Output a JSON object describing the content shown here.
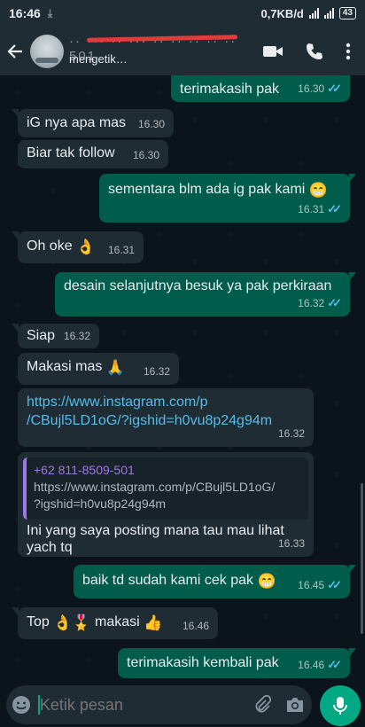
{
  "status": {
    "time": "16:46",
    "speed": "0,7KB/d",
    "battery": "43"
  },
  "header": {
    "subtitle": "mengetik…",
    "name_fragment": "·· ··· ·· ··· ·· ·· ·· ·· ·· 501"
  },
  "messages": [
    {
      "id": "m1",
      "text": "terimakasih pak",
      "time": "16.30"
    },
    {
      "id": "m2",
      "text": "iG nya apa mas",
      "time": "16.30"
    },
    {
      "id": "m3",
      "text": "Biar tak follow",
      "time": "16.30"
    },
    {
      "id": "m4",
      "text": "sementara blm ada ig pak kami",
      "emoji": "😁",
      "time": "16.31"
    },
    {
      "id": "m5",
      "text": "Oh oke",
      "emoji": "👌",
      "time": "16.31"
    },
    {
      "id": "m6",
      "text": "desain selanjutnya besuk ya pak perkiraan",
      "time": "16.32"
    },
    {
      "id": "m7",
      "text": "Siap",
      "time": "16.32"
    },
    {
      "id": "m8",
      "text": "Makasi mas",
      "emoji": "🙏",
      "time": "16.32"
    },
    {
      "id": "m9",
      "line1": "https://www.instagram.com/p",
      "line2": "/CBujl5LD1oG/?igshid=h0vu8p24g94m",
      "time": "16.32"
    },
    {
      "id": "m10",
      "quote_name": "+62 811-8509-501",
      "quote_line1": "https://www.instagram.com/p/CBujl5LD1oG/",
      "quote_line2": "?igshid=h0vu8p24g94m",
      "line1": "Ini yang saya posting mana tau mau lihat",
      "line2": "yach tq",
      "time": "16.33"
    },
    {
      "id": "m11",
      "text": "baik td sudah kami cek pak",
      "emoji": "😁",
      "time": "16.45"
    },
    {
      "id": "m12",
      "text1": "Top",
      "emoji1": "👌",
      "emoji2": "🎖️",
      "text2": "makasi",
      "emoji3": "👍",
      "time": "16.46"
    },
    {
      "id": "m13",
      "text": "terimakasih kembali pak",
      "time": "16.46"
    }
  ],
  "composer": {
    "placeholder": "Ketik pesan"
  },
  "colors": {
    "incoming": "#1f2c34",
    "outgoing": "#005c4b",
    "accent": "#00a884",
    "read_ticks": "#53bdeb"
  }
}
